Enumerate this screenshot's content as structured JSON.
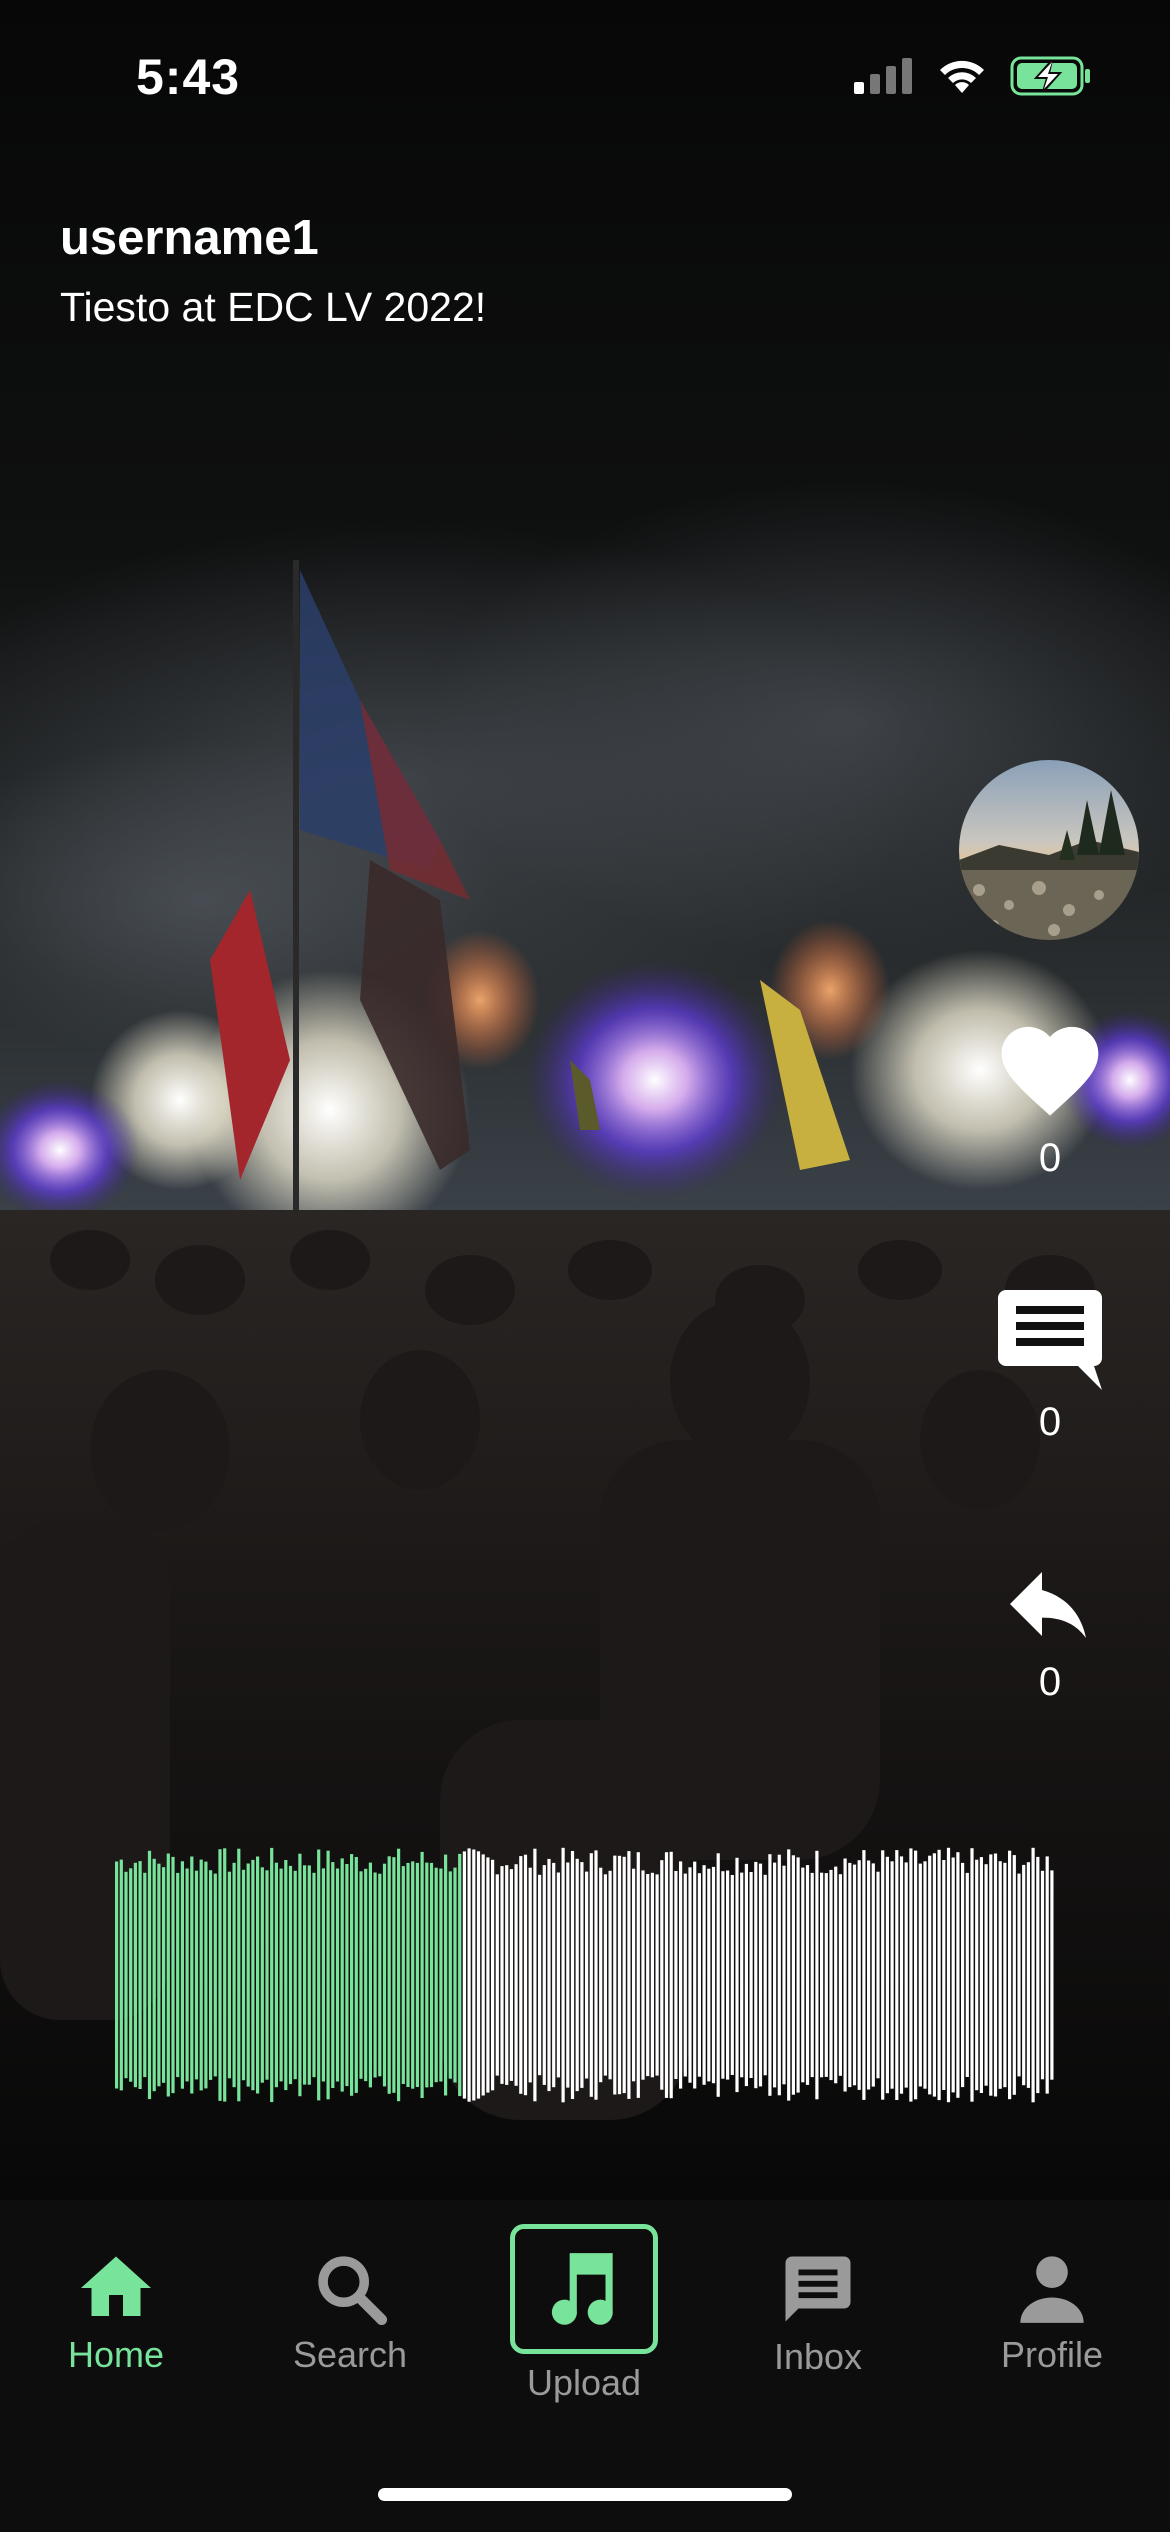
{
  "status_bar": {
    "time": "5:43",
    "icons": [
      "cellular-signal-icon",
      "wifi-icon",
      "battery-charging-icon"
    ]
  },
  "post": {
    "username": "username1",
    "caption": "Tiesto at EDC LV 2022!"
  },
  "actions": {
    "likes": "0",
    "comments": "0",
    "shares": "0"
  },
  "audio": {
    "progress": 0.37
  },
  "tabs": [
    {
      "label": "Home",
      "icon": "home-icon",
      "active": true
    },
    {
      "label": "Search",
      "icon": "search-icon",
      "active": false
    },
    {
      "label": "Upload",
      "icon": "music-note-icon",
      "active": false
    },
    {
      "label": "Inbox",
      "icon": "chat-icon",
      "active": false
    },
    {
      "label": "Profile",
      "icon": "person-icon",
      "active": false
    }
  ],
  "colors": {
    "accent": "#78e39a",
    "inactive": "#9a9a9a",
    "tab_bar_bg": "#0d0d0d"
  }
}
